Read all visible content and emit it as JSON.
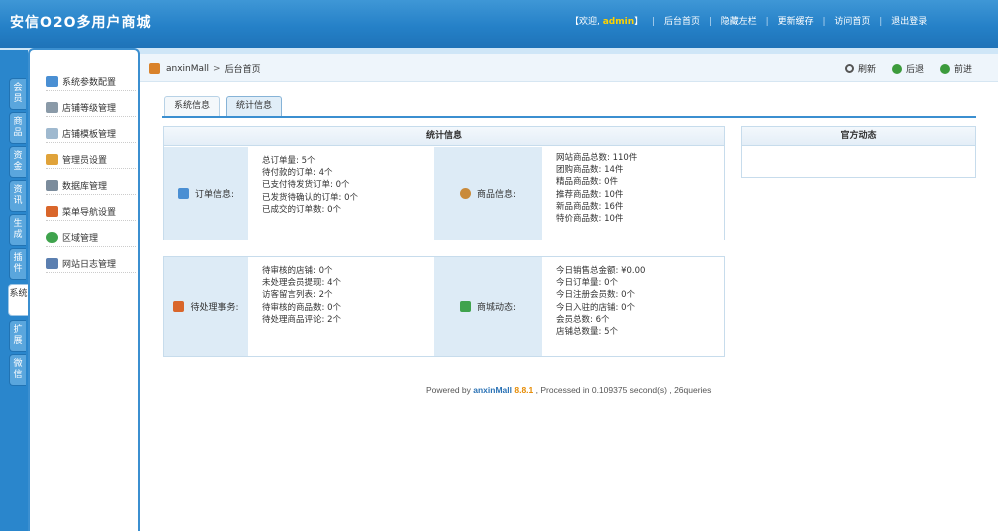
{
  "app": {
    "title": "安信O2O多用户商城"
  },
  "topnav": {
    "welcome_prefix": "【欢迎, ",
    "username": "admin",
    "welcome_suffix": "】",
    "links": [
      "后台首页",
      "隐藏左栏",
      "更新缓存",
      "访问首页",
      "退出登录"
    ]
  },
  "vtabs": [
    "会员",
    "商品",
    "资金",
    "资讯",
    "生成",
    "插件",
    "系统",
    "扩展",
    "微信"
  ],
  "sidebar": {
    "items": [
      {
        "label": "系统参数配置",
        "icon": "monitor-icon"
      },
      {
        "label": "店铺等级管理",
        "icon": "store-icon"
      },
      {
        "label": "店铺模板管理",
        "icon": "folder-icon"
      },
      {
        "label": "管理员设置",
        "icon": "admin-user-icon"
      },
      {
        "label": "数据库管理",
        "icon": "database-icon"
      },
      {
        "label": "菜单导航设置",
        "icon": "menu-nav-icon"
      },
      {
        "label": "区域管理",
        "icon": "globe-icon"
      },
      {
        "label": "网站日志管理",
        "icon": "pen-icon"
      }
    ]
  },
  "breadcrumb": {
    "site": "anxinMall",
    "page": "后台首页"
  },
  "actions": {
    "refresh": "刷新",
    "back": "后退",
    "forward": "前进"
  },
  "tabs": [
    "系统信息",
    "统计信息"
  ],
  "stats": {
    "title": "统计信息",
    "orders": {
      "label": "订单信息:",
      "lines": [
        "总订单量: 5个",
        "待付款的订单: 4个",
        "已支付待发货订单: 0个",
        "已发货待确认的订单: 0个",
        "已成交的订单数: 0个"
      ]
    },
    "goods": {
      "label": "商品信息:",
      "lines": [
        "网站商品总数: 110件",
        "团购商品数: 14件",
        "精品商品数: 0件",
        "推荐商品数: 10件",
        "新品商品数: 16件",
        "特价商品数: 10件"
      ]
    },
    "pending": {
      "label": "待处理事务:",
      "lines": [
        "待审核的店铺: 0个",
        "未处理会员提现: 4个",
        "访客留言列表: 2个",
        "待审核的商品数: 0个",
        "待处理商品评论: 2个"
      ]
    },
    "dynamics": {
      "label": "商城动态:",
      "lines": [
        "今日销售总金额: ¥0.00",
        "今日订单量: 0个",
        "今日注册会员数: 0个",
        "今日入驻的店铺: 0个",
        "会员总数: 6个",
        "店铺总数量: 5个"
      ]
    }
  },
  "official": {
    "title": "官方动态"
  },
  "footer": {
    "prefix": "Powered by ",
    "brand": "anxinMall",
    "version": "8.8.1",
    "suffix": ", Processed in 0.109375 second(s) , 26queries"
  },
  "colors": {
    "header_blue": "#2581c8",
    "label_bg": "#ddebf6",
    "admin_yellow": "#ffd200"
  }
}
